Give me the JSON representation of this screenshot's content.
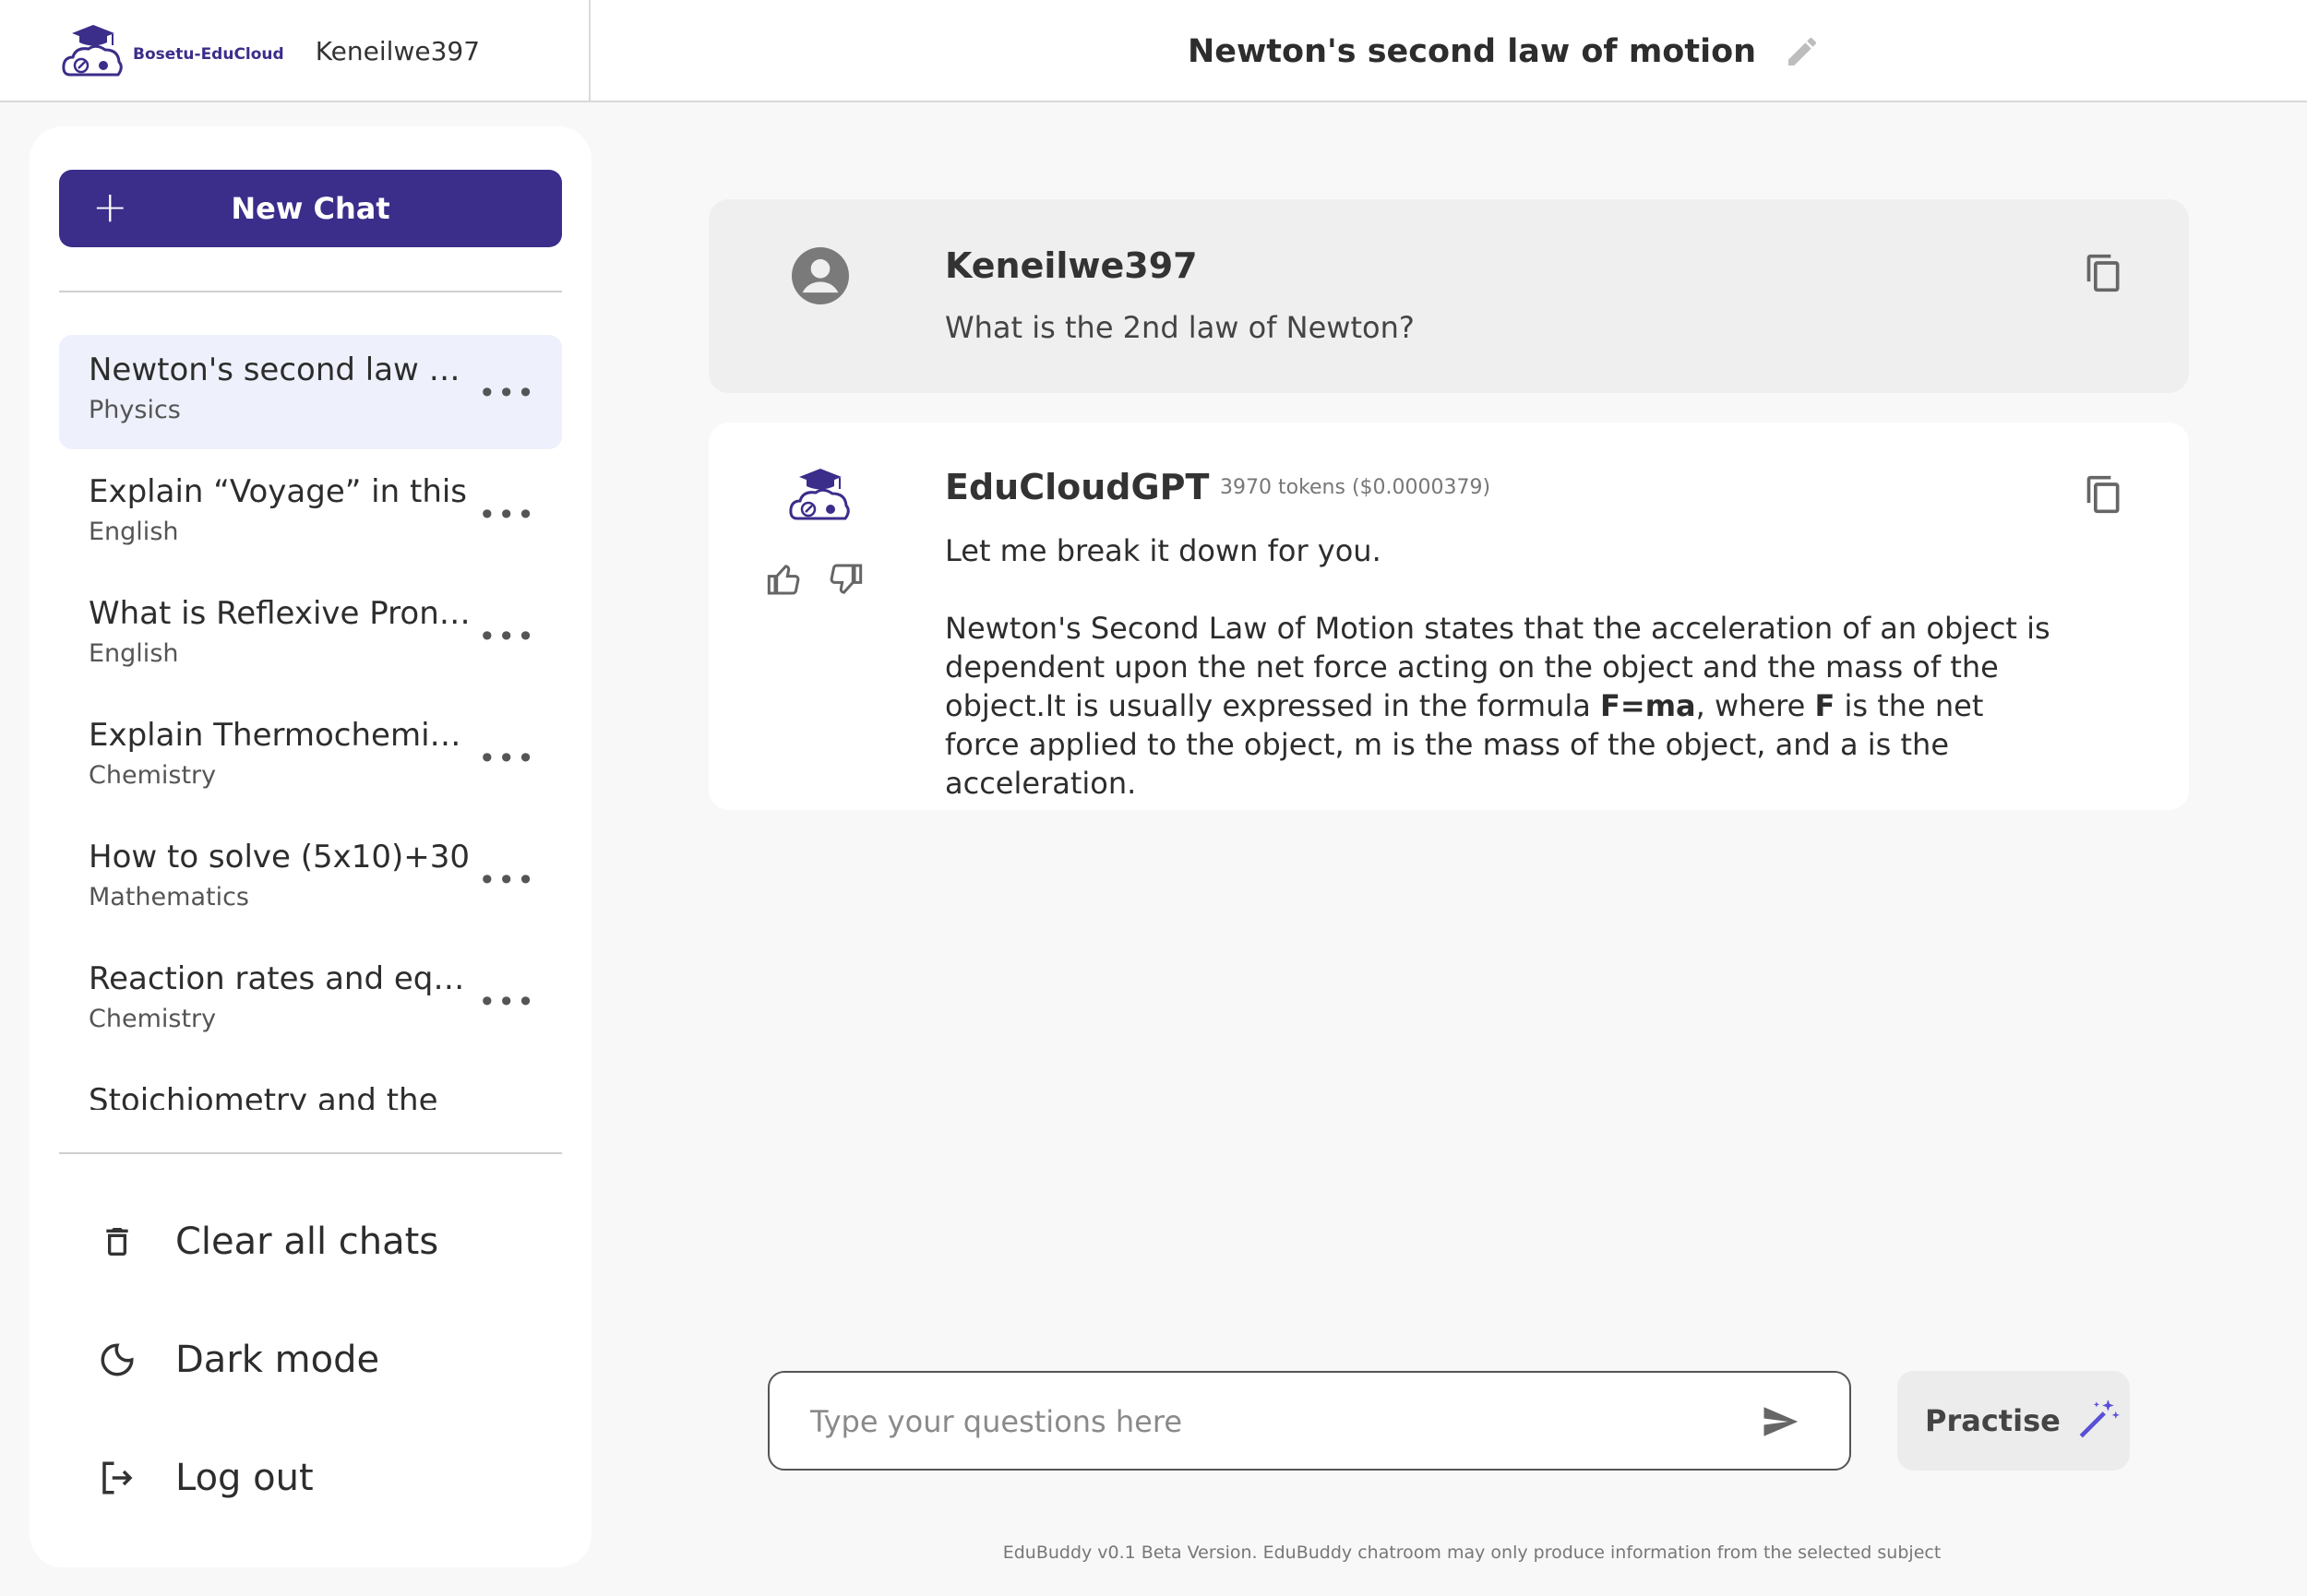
{
  "header": {
    "logo_text": "Bosetu-EduCloud",
    "username": "Keneilwe397",
    "chat_title": "Newton's second law of motion"
  },
  "sidebar": {
    "new_chat_label": "New Chat",
    "chats": [
      {
        "title": "Newton's second law of motion",
        "subject": "Physics"
      },
      {
        "title": "Explain “Voyage” in this",
        "subject": "English"
      },
      {
        "title": "What is Reflexive Pronouns",
        "subject": "English"
      },
      {
        "title": "Explain Thermochemistry",
        "subject": "Chemistry"
      },
      {
        "title": "How to solve (5x10)+30",
        "subject": "Mathematics"
      },
      {
        "title": "Reaction rates and equilibrium",
        "subject": "Chemistry"
      },
      {
        "title": "Stoichiometry and the",
        "subject": ""
      }
    ],
    "actions": {
      "clear": "Clear all chats",
      "dark": "Dark mode",
      "logout": "Log out"
    }
  },
  "messages": {
    "user": {
      "name": "Keneilwe397",
      "text": "What is the 2nd law of Newton?"
    },
    "bot": {
      "name": "EduCloudGPT",
      "tokens": "3970 tokens ($0.0000379)",
      "intro": "Let me break it down for you.",
      "body_part1": "Newton's Second Law of Motion states that the acceleration of an object is dependent upon the net force acting on the object and the mass of the object.It is usually expressed in the formula ",
      "formula": "F=ma",
      "body_part2": ", where ",
      "force_symbol": "F",
      "body_part3": " is the net force applied to the object, m is the mass of the object, and a is the acceleration."
    }
  },
  "input": {
    "placeholder": "Type your questions here",
    "value": ""
  },
  "practise_label": "Practise",
  "footer": "EduBuddy v0.1 Beta Version. EduBuddy chatroom may only produce information from the selected subject",
  "colors": {
    "brand": "#3b2d8a",
    "active_chat_bg": "#eef1fb",
    "accent_icon": "#5a4fd6"
  }
}
